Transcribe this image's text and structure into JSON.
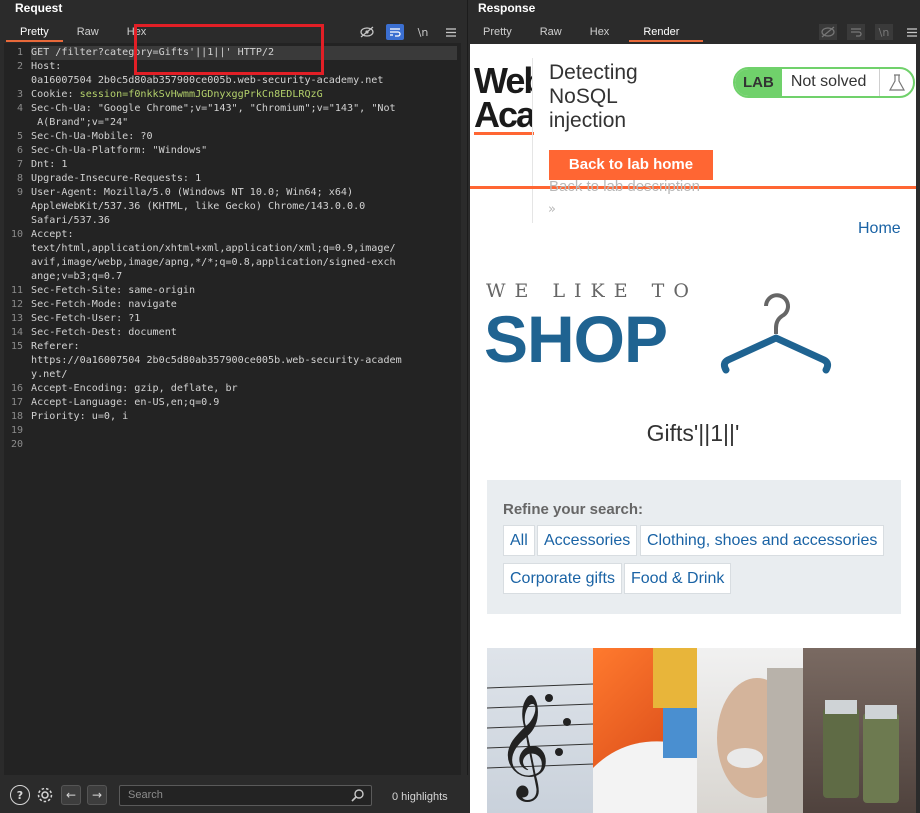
{
  "request": {
    "title": "Request",
    "tabs": [
      "Pretty",
      "Raw",
      "Hex"
    ],
    "icons": [
      "eye-slash-icon",
      "wrap-icon",
      "newline-icon",
      "menu-icon"
    ],
    "newline_label": "\\n",
    "lines": [
      {
        "n": "1",
        "text": "GET /filter?category=Gifts'||1||' HTTP/2"
      },
      {
        "n": "2",
        "text": "Host:"
      },
      {
        "n": "",
        "text": "0a16007504 2b0c5d80ab357900ce005b.web-security-academy.net"
      },
      {
        "n": "3",
        "text": "Cookie: session=f0nkkSvHwmmJGDnyxggPrkCn8EDLRQzG"
      },
      {
        "n": "4",
        "text": "Sec-Ch-Ua: \"Google Chrome\";v=\"143\", \"Chromium\";v=\"143\", \"Not"
      },
      {
        "n": "",
        "text": " A(Brand\";v=\"24\""
      },
      {
        "n": "5",
        "text": "Sec-Ch-Ua-Mobile: ?0"
      },
      {
        "n": "6",
        "text": "Sec-Ch-Ua-Platform: \"Windows\""
      },
      {
        "n": "7",
        "text": "Dnt: 1"
      },
      {
        "n": "8",
        "text": "Upgrade-Insecure-Requests: 1"
      },
      {
        "n": "9",
        "text": "User-Agent: Mozilla/5.0 (Windows NT 10.0; Win64; x64)"
      },
      {
        "n": "",
        "text": "AppleWebKit/537.36 (KHTML, like Gecko) Chrome/143.0.0.0"
      },
      {
        "n": "",
        "text": "Safari/537.36"
      },
      {
        "n": "10",
        "text": "Accept:"
      },
      {
        "n": "",
        "text": "text/html,application/xhtml+xml,application/xml;q=0.9,image/"
      },
      {
        "n": "",
        "text": "avif,image/webp,image/apng,*/*;q=0.8,application/signed-exch"
      },
      {
        "n": "",
        "text": "ange;v=b3;q=0.7"
      },
      {
        "n": "11",
        "text": "Sec-Fetch-Site: same-origin"
      },
      {
        "n": "12",
        "text": "Sec-Fetch-Mode: navigate"
      },
      {
        "n": "13",
        "text": "Sec-Fetch-User: ?1"
      },
      {
        "n": "14",
        "text": "Sec-Fetch-Dest: document"
      },
      {
        "n": "15",
        "text": "Referer:"
      },
      {
        "n": "",
        "text": "https://0a16007504 2b0c5d80ab357900ce005b.web-security-academ"
      },
      {
        "n": "",
        "text": "y.net/"
      },
      {
        "n": "16",
        "text": "Accept-Encoding: gzip, deflate, br"
      },
      {
        "n": "17",
        "text": "Accept-Language: en-US,en;q=0.9"
      },
      {
        "n": "18",
        "text": "Priority: u=0, i"
      },
      {
        "n": "19",
        "text": ""
      },
      {
        "n": "20",
        "text": ""
      }
    ],
    "search_placeholder": "Search",
    "highlights": "0 highlights"
  },
  "response": {
    "title": "Response",
    "tabs": [
      "Pretty",
      "Raw",
      "Hex",
      "Render"
    ],
    "active_tab": "Render",
    "newline_label": "\\n",
    "render": {
      "logo_text": "Web Aca",
      "lab_title": "Detecting NoSQL injection",
      "back_button": "Back to lab home",
      "back_desc": "Back to lab description",
      "chevron": "»",
      "badge_lab": "LAB",
      "badge_status": "Not solved",
      "home_link": "Home",
      "shop_small": "WE LIKE TO",
      "shop_big": "SHOP",
      "category_title": "Gifts'||1||'",
      "refine_label": "Refine your search:",
      "filters": [
        "All",
        "Accessories",
        "Clothing, shoes and accessories",
        "Corporate gifts",
        "Food & Drink"
      ]
    }
  },
  "colors": {
    "accent_orange": "#ff6633",
    "link_blue": "#1a63a5",
    "shop_blue": "#1f6391",
    "lab_green": "#70d16b",
    "highlight_red": "#e21f26"
  }
}
